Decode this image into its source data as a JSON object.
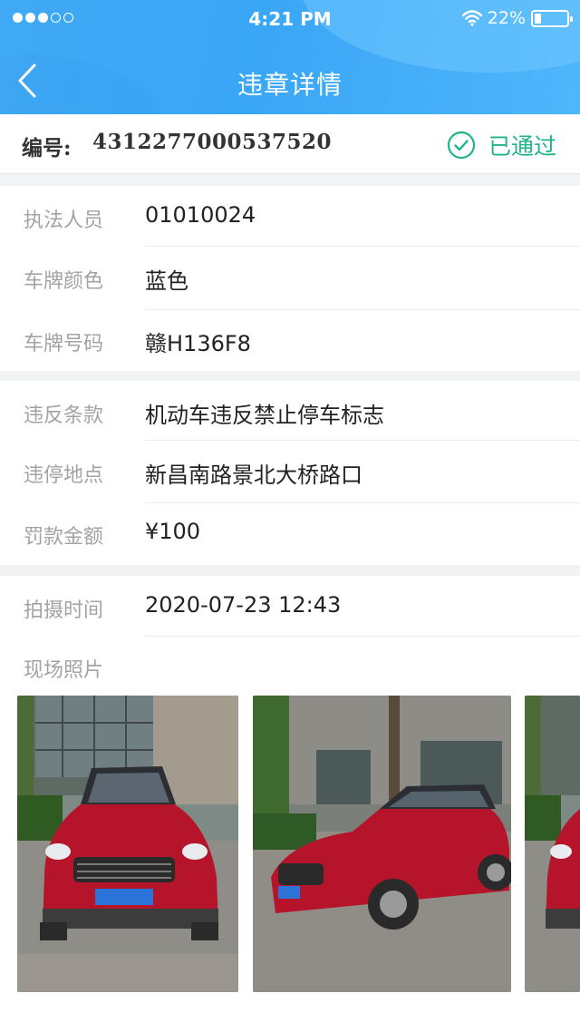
{
  "status_bar": {
    "time": "4:21 PM",
    "battery": "22%",
    "battery_level": 0.22
  },
  "nav": {
    "title": "违章详情",
    "back_icon": "chevron-left-icon"
  },
  "record": {
    "number_label": "编号:",
    "number": "4312277000537520",
    "status": "已通过",
    "status_icon": "check-circle-icon",
    "status_color": "#1fb58a"
  },
  "section1": [
    {
      "key": "执法人员",
      "value": "01010024"
    },
    {
      "key": "车牌颜色",
      "value": "蓝色"
    },
    {
      "key": "车牌号码",
      "value": "赣H136F8"
    }
  ],
  "section2": [
    {
      "key": "违反条款",
      "value": "机动车违反禁止停车标志"
    },
    {
      "key": "违停地点",
      "value": "新昌南路景北大桥路口"
    },
    {
      "key": "罚款金额",
      "value": "¥100"
    }
  ],
  "section3": {
    "time_key": "拍摄时间",
    "time_value": "2020-07-23 12:43",
    "photos_key": "现场照片"
  },
  "colors": {
    "header": "#3fa9f5",
    "car": "#b5142a",
    "plate": "#2a73d8"
  }
}
